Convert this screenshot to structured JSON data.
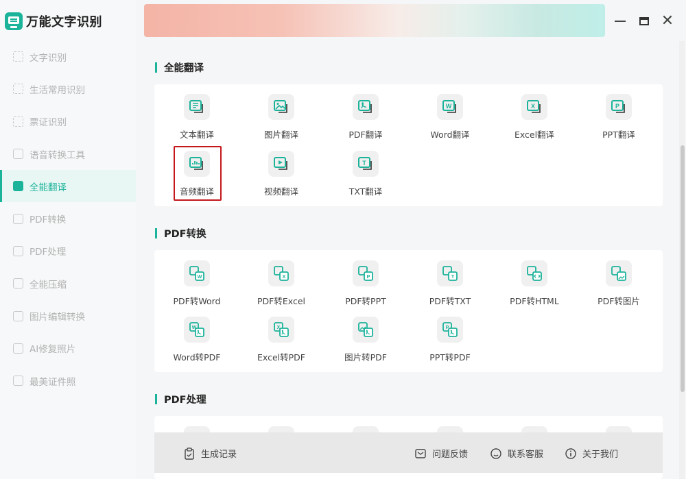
{
  "app": {
    "title": "万能文字识别"
  },
  "sidebar": {
    "items": [
      {
        "label": "文字识别",
        "icon": "scan-text-icon"
      },
      {
        "label": "生活常用识别",
        "icon": "scan-life-icon"
      },
      {
        "label": "票证识别",
        "icon": "scan-ticket-icon"
      },
      {
        "label": "语音转换工具",
        "icon": "voice-tool-icon"
      },
      {
        "label": "全能翻译",
        "icon": "translate-icon",
        "active": true
      },
      {
        "label": "PDF转换",
        "icon": "pdf-convert-icon"
      },
      {
        "label": "PDF处理",
        "icon": "pdf-process-icon"
      },
      {
        "label": "全能压缩",
        "icon": "compress-icon"
      },
      {
        "label": "图片编辑转换",
        "icon": "image-edit-icon"
      },
      {
        "label": "AI修复照片",
        "icon": "ai-repair-icon"
      },
      {
        "label": "最美证件照",
        "icon": "id-photo-icon"
      }
    ]
  },
  "sections": {
    "translate": {
      "title": "全能翻译",
      "tools": [
        {
          "label": "文本翻译",
          "icon": "text-translate-icon"
        },
        {
          "label": "图片翻译",
          "icon": "image-translate-icon"
        },
        {
          "label": "PDF翻译",
          "icon": "pdf-translate-icon"
        },
        {
          "label": "Word翻译",
          "icon": "word-translate-icon"
        },
        {
          "label": "Excel翻译",
          "icon": "excel-translate-icon"
        },
        {
          "label": "PPT翻译",
          "icon": "ppt-translate-icon"
        },
        {
          "label": "音频翻译",
          "icon": "audio-translate-icon",
          "highlighted": true
        },
        {
          "label": "视频翻译",
          "icon": "video-translate-icon"
        },
        {
          "label": "TXT翻译",
          "icon": "txt-translate-icon"
        }
      ]
    },
    "pdf_convert": {
      "title": "PDF转换",
      "tools": [
        {
          "label": "PDF转Word",
          "icon": "pdf-to-word-icon"
        },
        {
          "label": "PDF转Excel",
          "icon": "pdf-to-excel-icon"
        },
        {
          "label": "PDF转PPT",
          "icon": "pdf-to-ppt-icon"
        },
        {
          "label": "PDF转TXT",
          "icon": "pdf-to-txt-icon"
        },
        {
          "label": "PDF转HTML",
          "icon": "pdf-to-html-icon"
        },
        {
          "label": "PDF转图片",
          "icon": "pdf-to-image-icon"
        },
        {
          "label": "Word转PDF",
          "icon": "word-to-pdf-icon"
        },
        {
          "label": "Excel转PDF",
          "icon": "excel-to-pdf-icon"
        },
        {
          "label": "图片转PDF",
          "icon": "image-to-pdf-icon"
        },
        {
          "label": "PPT转PDF",
          "icon": "ppt-to-pdf-icon"
        }
      ]
    },
    "pdf_process": {
      "title": "PDF处理"
    }
  },
  "bottombar": {
    "history": "生成记录",
    "feedback": "问题反馈",
    "service": "联系客服",
    "about": "关于我们"
  },
  "colors": {
    "accent": "#1bb39a",
    "highlight_border": "#c4161c"
  }
}
